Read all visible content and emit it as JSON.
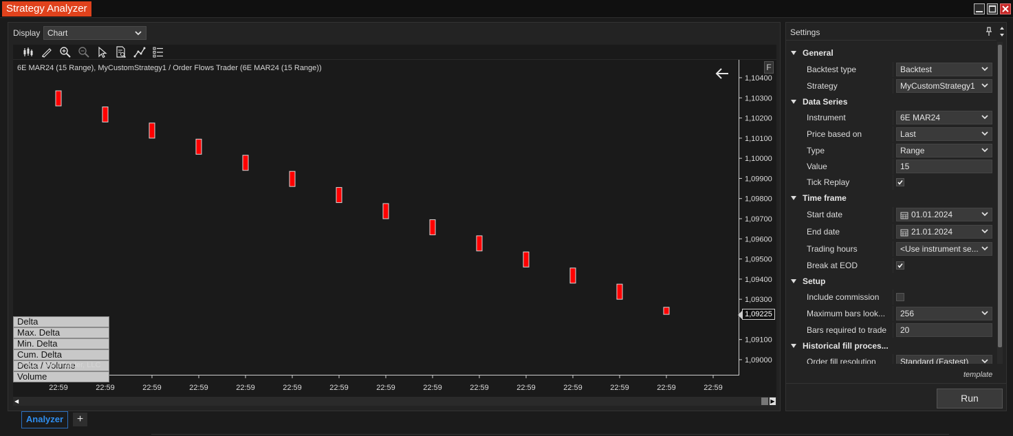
{
  "window": {
    "title": "Strategy Analyzer"
  },
  "display": {
    "label": "Display",
    "value": "Chart"
  },
  "chart_header": "6E MAR24 (15 Range), MyCustomStrategy1 /  Order Flows Trader (6E MAR24 (15 Range))",
  "f_button": "F",
  "copyright": "© 2024 NinjaTrader, LLC",
  "indicators": [
    "Delta",
    "Max. Delta",
    "Min. Delta",
    "Cum. Delta",
    "Delta / Volume",
    "Volume"
  ],
  "chart_data": {
    "type": "candlestick",
    "y_ticks": [
      "1,10400",
      "1,10300",
      "1,10200",
      "1,10100",
      "1,10000",
      "1,09900",
      "1,09800",
      "1,09700",
      "1,09600",
      "1,09500",
      "1,09400",
      "1,09300",
      "1,09100",
      "1,09000"
    ],
    "y_tick_values": [
      1.104,
      1.103,
      1.102,
      1.101,
      1.1,
      1.099,
      1.098,
      1.097,
      1.096,
      1.095,
      1.094,
      1.093,
      1.091,
      1.09
    ],
    "ylim": [
      1.0895,
      1.1055
    ],
    "x_labels": [
      "22:59",
      "22:59",
      "22:59",
      "22:59",
      "22:59",
      "22:59",
      "22:59",
      "22:59",
      "22:59",
      "22:59",
      "22:59",
      "22:59",
      "22:59",
      "22:59",
      "22:59"
    ],
    "bars": [
      {
        "open": 1.10335,
        "close": 1.1026
      },
      {
        "open": 1.10255,
        "close": 1.1018
      },
      {
        "open": 1.10175,
        "close": 1.101
      },
      {
        "open": 1.10095,
        "close": 1.1002
      },
      {
        "open": 1.10015,
        "close": 1.0994
      },
      {
        "open": 1.09935,
        "close": 1.0986
      },
      {
        "open": 1.09855,
        "close": 1.0978
      },
      {
        "open": 1.09775,
        "close": 1.097
      },
      {
        "open": 1.09695,
        "close": 1.0962
      },
      {
        "open": 1.09615,
        "close": 1.0954
      },
      {
        "open": 1.09535,
        "close": 1.0946
      },
      {
        "open": 1.09455,
        "close": 1.0938
      },
      {
        "open": 1.09375,
        "close": 1.093
      },
      {
        "open": 1.0926,
        "close": 1.09225
      }
    ],
    "bar_color": "#ff0000",
    "last_price": "1,09225",
    "last_price_value": 1.09225
  },
  "settings": {
    "title": "Settings",
    "categories": {
      "general": "General",
      "data_series": "Data Series",
      "time_frame": "Time frame",
      "setup": "Setup",
      "historical": "Historical fill proces..."
    },
    "rows": {
      "backtest_type": {
        "label": "Backtest type",
        "value": "Backtest"
      },
      "strategy": {
        "label": "Strategy",
        "value": "MyCustomStrategy1"
      },
      "instrument": {
        "label": "Instrument",
        "value": "6E MAR24"
      },
      "price_based_on": {
        "label": "Price based on",
        "value": "Last"
      },
      "type": {
        "label": "Type",
        "value": "Range"
      },
      "value": {
        "label": "Value",
        "value": "15"
      },
      "tick_replay": {
        "label": "Tick Replay",
        "checked": true
      },
      "start_date": {
        "label": "Start date",
        "value": "01.01.2024"
      },
      "end_date": {
        "label": "End date",
        "value": "21.01.2024"
      },
      "trading_hours": {
        "label": "Trading hours",
        "value": "<Use instrument se..."
      },
      "break_at_eod": {
        "label": "Break at EOD",
        "checked": true
      },
      "include_commission": {
        "label": "Include commission",
        "checked": false
      },
      "max_bars_lookback": {
        "label": "Maximum bars look...",
        "value": "256"
      },
      "bars_required": {
        "label": "Bars required to trade",
        "value": "20"
      },
      "order_fill_resolution": {
        "label": "Order fill resolution",
        "value": "Standard (Fastest)"
      }
    },
    "template_link": "template",
    "run_label": "Run"
  },
  "tabs": {
    "analyzer": "Analyzer",
    "add": "+"
  },
  "colors": {
    "accent": "#e0421c",
    "tab_active": "#2e8ef0"
  }
}
